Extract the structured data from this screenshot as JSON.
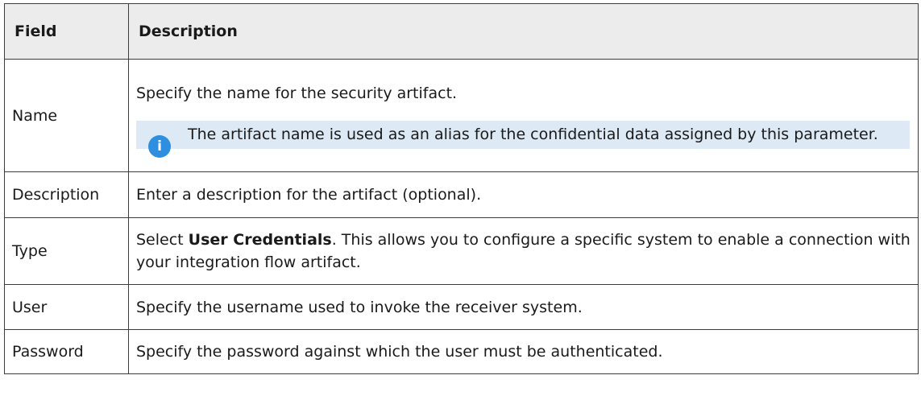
{
  "table": {
    "headers": {
      "field": "Field",
      "description": "Description"
    },
    "rows": {
      "name": {
        "field": "Name",
        "description": "Specify the name for the security artifact.",
        "note_icon": "info-icon",
        "note_icon_glyph": "i",
        "note": "The artifact name is used as an alias for the confidential data assigned by this parameter."
      },
      "description": {
        "field": "Description",
        "description": "Enter a description for the artifact (optional)."
      },
      "type": {
        "field": "Type",
        "description_prefix": "Select ",
        "description_bold": "User Credentials",
        "description_suffix": ". This allows you to configure a specific system to enable a connection with your integration flow artifact."
      },
      "user": {
        "field": "User",
        "description": "Specify the username used to invoke the receiver system."
      },
      "password": {
        "field": "Password",
        "description": "Specify the password against which the user must be authenticated."
      }
    }
  },
  "colors": {
    "header_background": "#ececec",
    "note_background": "#dde9f4",
    "info_icon": "#2e8fe0",
    "border": "#3c3c3c"
  }
}
